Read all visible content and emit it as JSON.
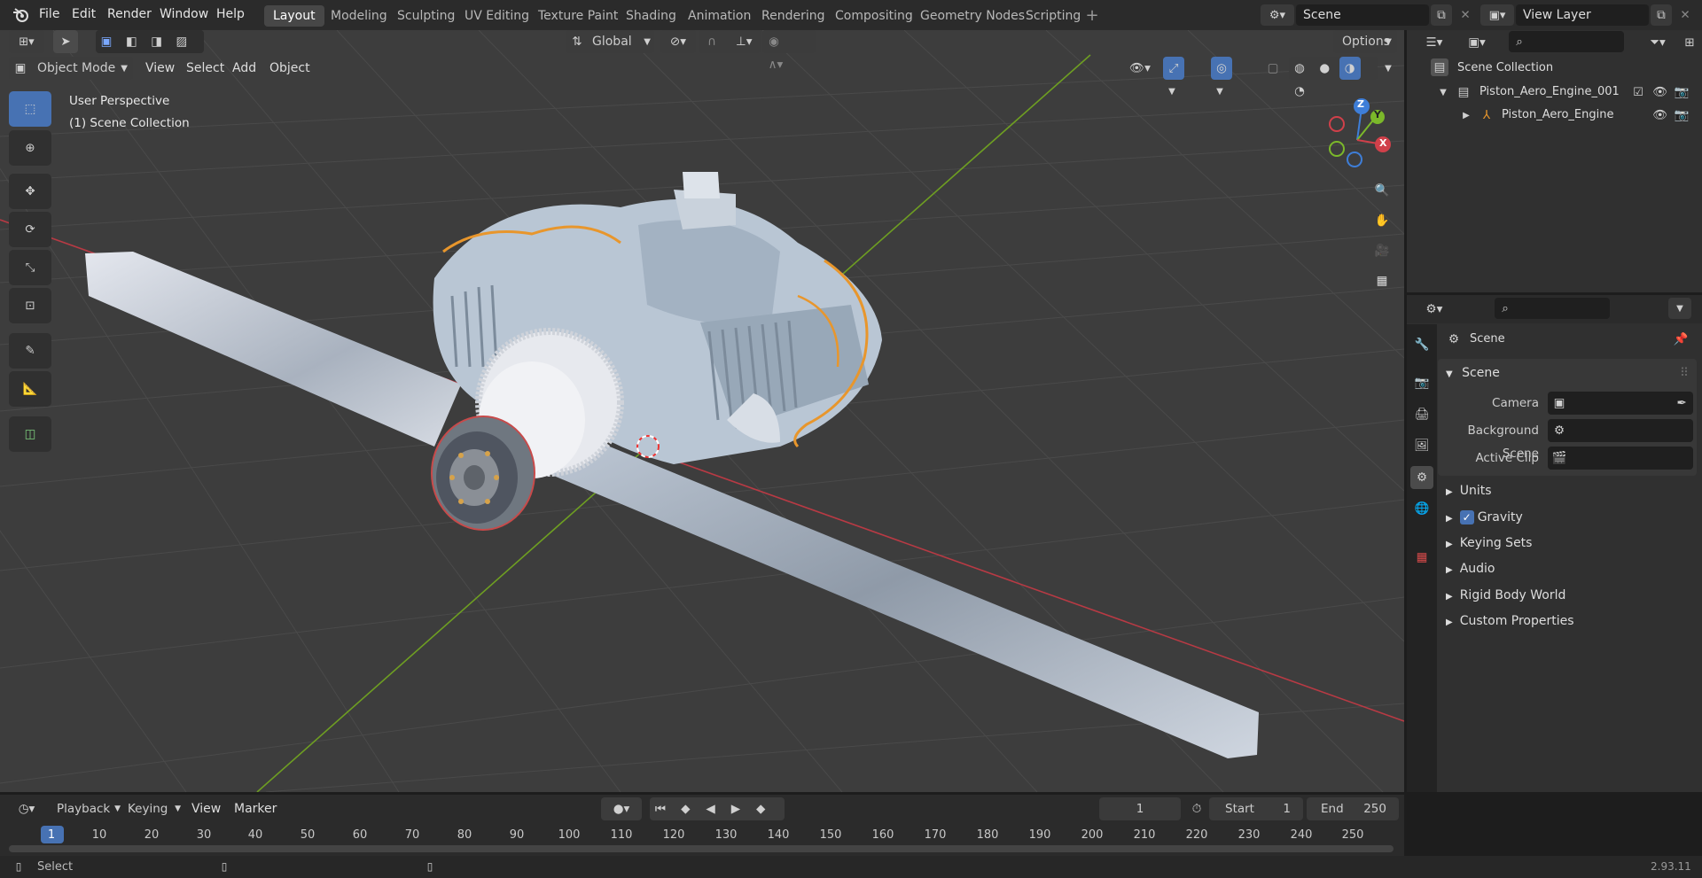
{
  "menu": {
    "file": "File",
    "edit": "Edit",
    "render": "Render",
    "window": "Window",
    "help": "Help"
  },
  "workspaces": [
    "Layout",
    "Modeling",
    "Sculpting",
    "UV Editing",
    "Texture Paint",
    "Shading",
    "Animation",
    "Rendering",
    "Compositing",
    "Geometry Nodes",
    "Scripting"
  ],
  "scene_field": "Scene",
  "view_layer_field": "View Layer",
  "viewport_header": {
    "mode": "Object Mode",
    "view": "View",
    "select": "Select",
    "add": "Add",
    "object": "Object",
    "transform_orientation": "Global",
    "options": "Options"
  },
  "viewport_info": {
    "line1": "User Perspective",
    "line2": "(1) Scene Collection"
  },
  "gizmo": {
    "x": "X",
    "y": "Y",
    "z": "Z"
  },
  "outliner": {
    "root": "Scene Collection",
    "collection": "Piston_Aero_Engine_001",
    "object": "Piston_Aero_Engine"
  },
  "properties": {
    "context": "Scene",
    "section_scene": "Scene",
    "camera_label": "Camera",
    "background_scene_label": "Background Scene",
    "active_clip_label": "Active Clip",
    "panels": [
      "Units",
      "Gravity",
      "Keying Sets",
      "Audio",
      "Rigid Body World",
      "Custom Properties"
    ],
    "gravity_enabled": true
  },
  "timeline": {
    "playback": "Playback",
    "keying": "Keying",
    "view": "View",
    "marker": "Marker",
    "current_frame": "1",
    "start_label": "Start",
    "start_value": "1",
    "end_label": "End",
    "end_value": "250",
    "ticks": [
      "1",
      "10",
      "20",
      "30",
      "40",
      "50",
      "60",
      "70",
      "80",
      "90",
      "100",
      "110",
      "120",
      "130",
      "140",
      "150",
      "160",
      "170",
      "180",
      "190",
      "200",
      "210",
      "220",
      "230",
      "240",
      "250"
    ]
  },
  "status": {
    "select": "Select",
    "version": "2.93.11"
  },
  "colors": {
    "accent": "#4772b3",
    "x_axis": "#d0404a",
    "y_axis": "#7bb82a",
    "z_axis": "#3e7ed8",
    "viewport_bg": "#3d3d3d",
    "wire": "#e8962c"
  }
}
